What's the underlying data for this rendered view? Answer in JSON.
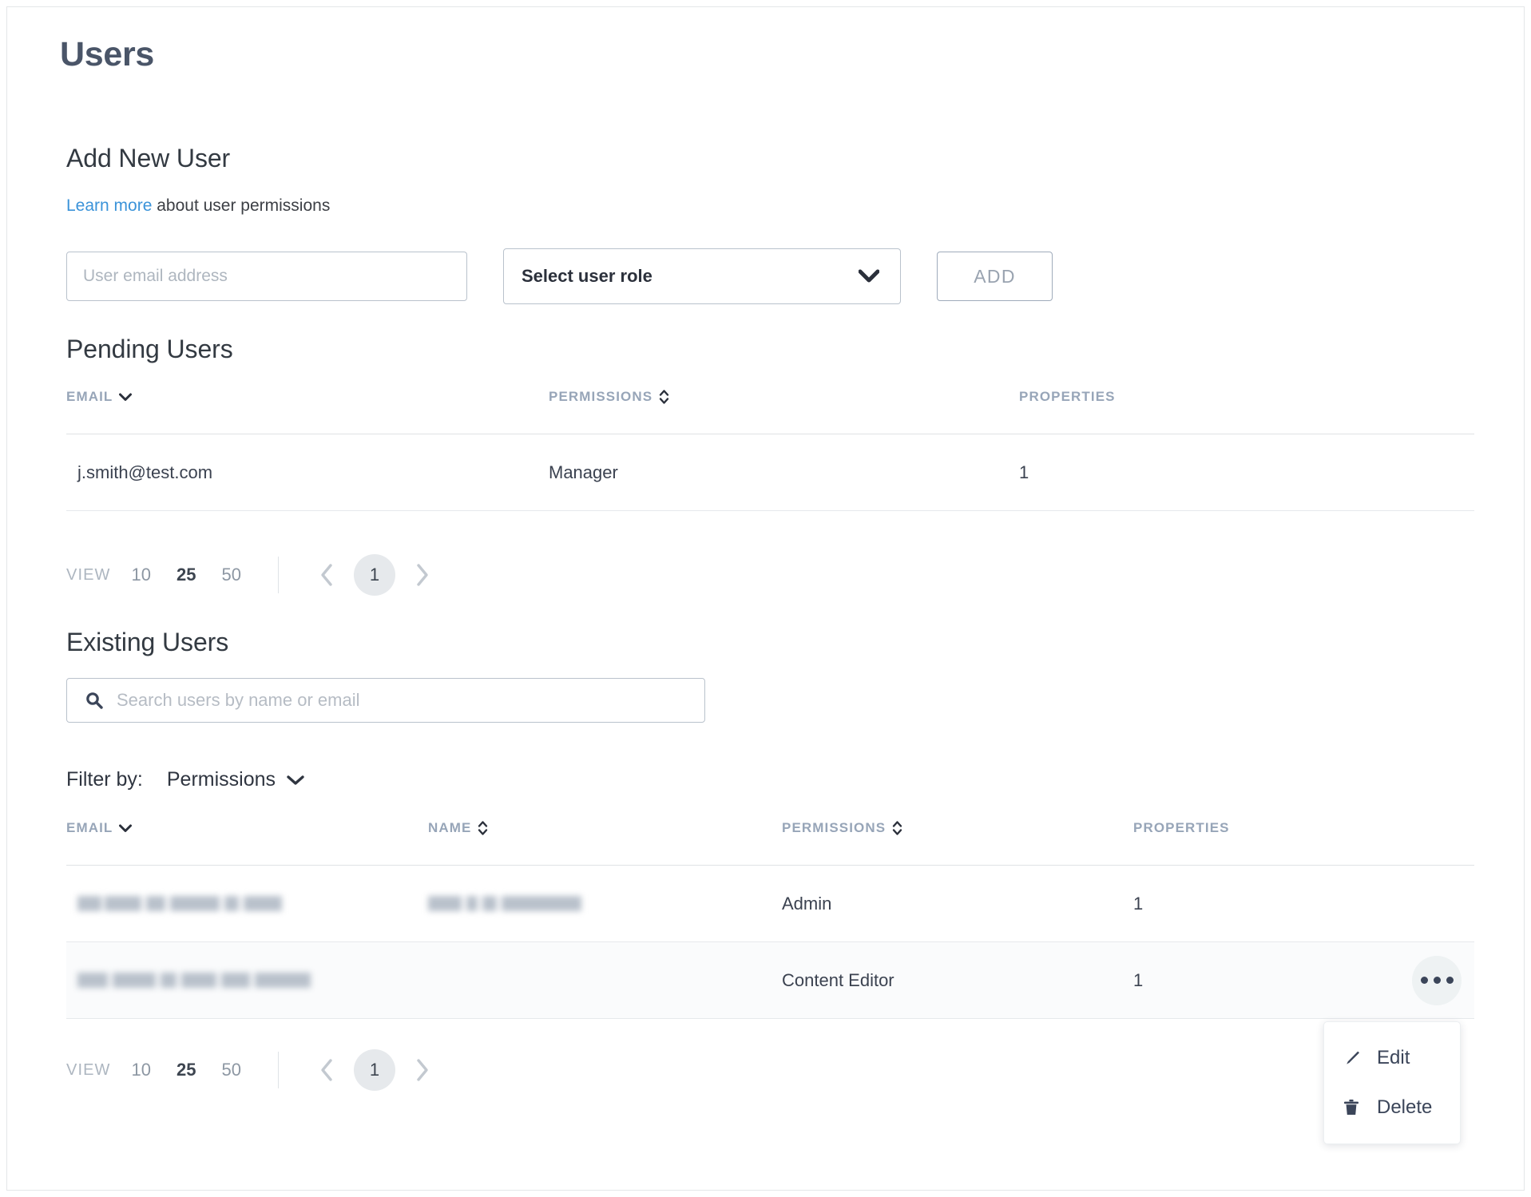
{
  "page": {
    "title": "Users"
  },
  "add_new_user": {
    "heading": "Add New User",
    "learn_more_link": "Learn more",
    "learn_more_rest": " about user permissions",
    "email_placeholder": "User email address",
    "email_value": "",
    "role_select_value": "Select user role",
    "role_chevron_icon": "chevron-down-icon",
    "add_button_label": "ADD"
  },
  "pending_users": {
    "heading": "Pending Users",
    "columns": [
      {
        "label": "EMAIL",
        "sort_icon": "chevron-down-icon"
      },
      {
        "label": "PERMISSIONS",
        "sort_icon": "chevron-up-down-icon"
      },
      {
        "label": "PROPERTIES",
        "sort_icon": "none"
      }
    ],
    "rows": [
      {
        "email": "j.smith@test.com",
        "permissions": "Manager",
        "properties": "1"
      }
    ],
    "pagination": {
      "view_label": "VIEW",
      "sizes": [
        "10",
        "25",
        "50"
      ],
      "active_size": "25",
      "prev_icon": "chevron-left-icon",
      "next_icon": "chevron-right-icon",
      "current_page": "1"
    }
  },
  "existing_users": {
    "heading": "Existing Users",
    "search": {
      "icon": "search-icon",
      "placeholder": "Search users by name or email",
      "value": ""
    },
    "filter": {
      "label": "Filter by:",
      "value": "Permissions",
      "chevron_icon": "chevron-down-icon"
    },
    "columns": [
      {
        "label": "EMAIL",
        "sort_icon": "chevron-down-icon"
      },
      {
        "label": "NAME",
        "sort_icon": "chevron-up-down-icon"
      },
      {
        "label": "PERMISSIONS",
        "sort_icon": "chevron-up-down-icon"
      },
      {
        "label": "PROPERTIES",
        "sort_icon": "none"
      }
    ],
    "rows": [
      {
        "email": "",
        "email_redacted": true,
        "name": "",
        "name_redacted": true,
        "permissions": "Admin",
        "properties": "1",
        "hovered": false,
        "kebab": false
      },
      {
        "email": "",
        "email_redacted": true,
        "name": "",
        "name_redacted": false,
        "permissions": "Content Editor",
        "properties": "1",
        "hovered": true,
        "kebab": true
      }
    ],
    "row_menu_icon": "kebab-menu-icon",
    "pagination": {
      "view_label": "VIEW",
      "sizes": [
        "10",
        "25",
        "50"
      ],
      "active_size": "25",
      "prev_icon": "chevron-left-icon",
      "next_icon": "chevron-right-icon",
      "current_page": "1"
    }
  },
  "context_menu": {
    "items": [
      {
        "label": "Edit",
        "icon": "pencil-icon"
      },
      {
        "label": "Delete",
        "icon": "trash-icon"
      }
    ]
  },
  "colors": {
    "title": "#4a5568",
    "link": "#3b93d9",
    "header_text": "#97a5b8",
    "body_text": "#3b4250",
    "border": "#b9c2cc",
    "divider": "#e6e9ec",
    "kebab_bg": "#eef2f3",
    "row_hover": "#fafbfc",
    "muted": "#adb6c0",
    "icon_dark": "#3b4559"
  }
}
